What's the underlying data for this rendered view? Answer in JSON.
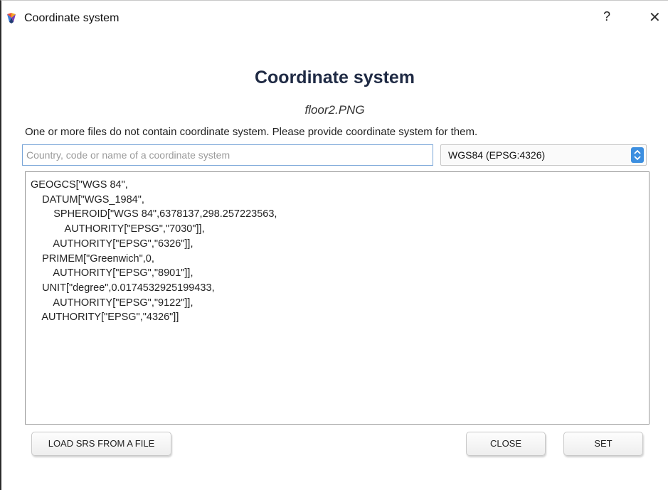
{
  "window": {
    "title": "Coordinate system",
    "help_label": "?",
    "close_label": "✕",
    "icon": "app-logo-icon"
  },
  "dialog": {
    "heading": "Coordinate system",
    "filename": "floor2.PNG",
    "message": "One or more files do not contain coordinate system. Please provide coordinate system for them.",
    "search": {
      "placeholder": "Country, code or name of a coordinate system",
      "value": ""
    },
    "crs_select": {
      "selected": "WGS84 (EPSG:4326)",
      "stepper_icon": "chevron-updown-icon",
      "stepper_color": "#3d8fe0"
    },
    "wkt_lines": [
      "GEOGCS[\"WGS 84\",",
      "    DATUM[\"WGS_1984\",",
      "        SPHEROID[\"WGS 84\",6378137,298.257223563,",
      "            AUTHORITY[\"EPSG\",\"7030\"]],",
      "        AUTHORITY[\"EPSG\",\"6326\"]],",
      "    PRIMEM[\"Greenwich\",0,",
      "        AUTHORITY[\"EPSG\",\"8901\"]],",
      "    UNIT[\"degree\",0.0174532925199433,",
      "        AUTHORITY[\"EPSG\",\"9122\"]],",
      "    AUTHORITY[\"EPSG\",\"4326\"]]"
    ]
  },
  "buttons": {
    "load": "LOAD SRS FROM A FILE",
    "close": "CLOSE",
    "set": "SET"
  },
  "colors": {
    "heading": "#1f2a44",
    "input_focus_border": "#7aa6d8"
  }
}
